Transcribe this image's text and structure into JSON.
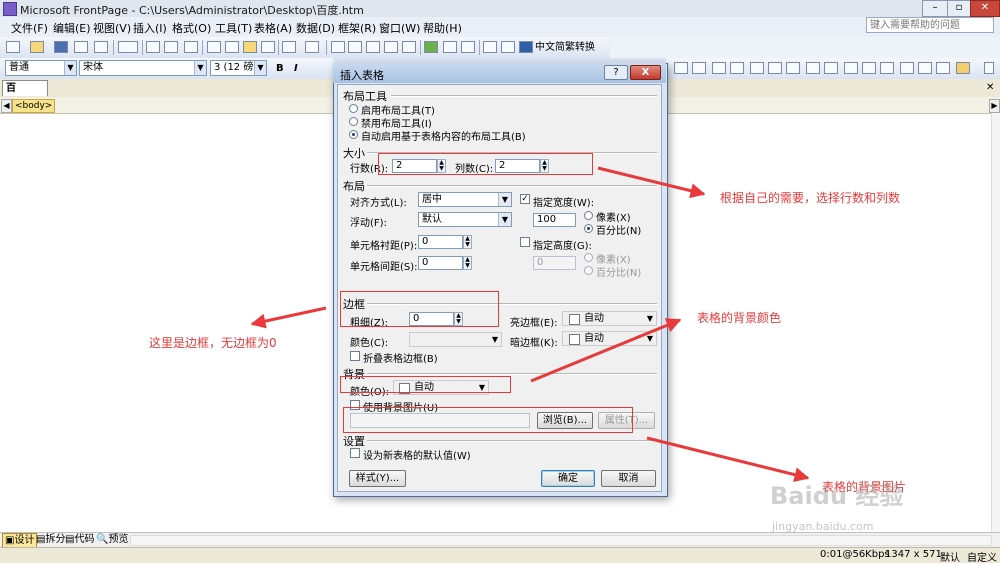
{
  "window": {
    "title": "Microsoft FrontPage - C:\\Users\\Administrator\\Desktop\\百度.htm",
    "help_search_placeholder": "键入需要帮助的问题"
  },
  "menu": [
    "文件(F)",
    "编辑(E)",
    "视图(V)",
    "插入(I)",
    "格式(O)",
    "工具(T)",
    "表格(A)",
    "数据(D)",
    "框架(R)",
    "窗口(W)",
    "帮助(H)"
  ],
  "toolbar": {
    "convert_label": "中文简繁转换",
    "style_value": "普通",
    "font_value": "宋体",
    "size_value": "3 (12 磅)",
    "bold": "B",
    "italic": "I"
  },
  "document": {
    "tab": "百度.htm",
    "tag": "<body>"
  },
  "dialog": {
    "title": "插入表格",
    "help_btn": "?",
    "close_btn": "X",
    "layout_tools": {
      "heading": "布局工具",
      "options": [
        "启用布局工具(T)",
        "禁用布局工具(I)",
        "自动启用基于表格内容的布局工具(B)"
      ],
      "selected": 2
    },
    "size": {
      "heading": "大小",
      "rows_label": "行数(R):",
      "rows_value": "2",
      "cols_label": "列数(C):",
      "cols_value": "2"
    },
    "layout": {
      "heading": "布局",
      "align_label": "对齐方式(L):",
      "align_value": "居中",
      "float_label": "浮动(F):",
      "float_value": "默认",
      "padding_label": "单元格衬距(P):",
      "padding_value": "0",
      "spacing_label": "单元格间距(S):",
      "spacing_value": "0",
      "width_check_label": "指定宽度(W):",
      "width_value": "100",
      "width_unit_px": "像素(X)",
      "width_unit_pct": "百分比(N)",
      "height_check_label": "指定高度(G):",
      "height_value": "0",
      "height_unit_px": "像素(X)",
      "height_unit_pct": "百分比(N)"
    },
    "border": {
      "heading": "边框",
      "size_label": "粗细(Z):",
      "size_value": "0",
      "color_label": "颜色(C):",
      "color_value": "",
      "light_label": "亮边框(E):",
      "light_value": "自动",
      "dark_label": "暗边框(K):",
      "dark_value": "自动",
      "collapse_label": "折叠表格边框(B)"
    },
    "background": {
      "heading": "背景",
      "color_label": "颜色(O):",
      "color_value": "自动",
      "use_image_label": "使用背景图片(U)",
      "browse_btn": "浏览(B)...",
      "properties_btn": "属性(T)..."
    },
    "settings": {
      "heading": "设置",
      "default_label": "设为新表格的默认值(W)"
    },
    "style_btn": "样式(Y)...",
    "ok_btn": "确定",
    "cancel_btn": "取消"
  },
  "annotations": {
    "rows_cols": "根据自己的需要，选择行数和列数",
    "border": "这里是边框，无边框为0",
    "bg_color": "表格的背景颜色",
    "bg_image": "表格的背景图片"
  },
  "view_tabs": [
    "设计",
    "拆分",
    "代码",
    "预览"
  ],
  "status": {
    "speed": "0:01@56Kbps",
    "dims": "1347 x 571",
    "default": "默认",
    "custom": "自定义"
  },
  "watermark": {
    "logo": "Baidu 经验",
    "url": "jingyan.baidu.com"
  }
}
